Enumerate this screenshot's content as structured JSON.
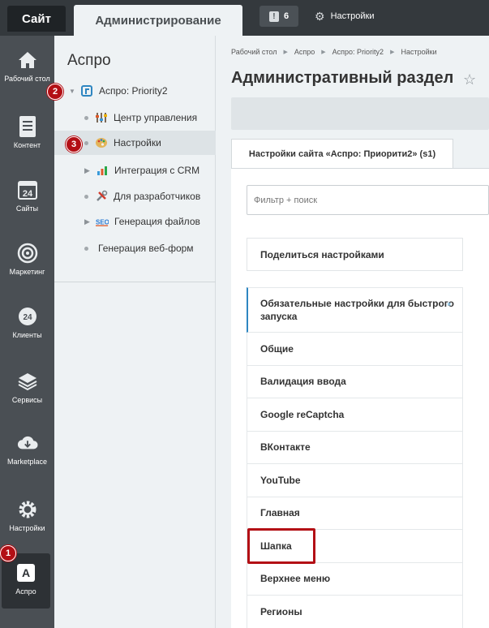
{
  "topbar": {
    "site_tab": "Сайт",
    "admin_tab": "Администрирование",
    "notifications_count": "6",
    "settings_label": "Настройки"
  },
  "leftmenu": {
    "items": [
      {
        "label": "Рабочий стол",
        "icon": "home-icon"
      },
      {
        "label": "Контент",
        "icon": "document-icon"
      },
      {
        "label": "Сайты",
        "icon": "calendar-24-icon"
      },
      {
        "label": "Маркетинг",
        "icon": "target-icon"
      },
      {
        "label": "Клиенты",
        "icon": "clients-24-icon"
      },
      {
        "label": "Сервисы",
        "icon": "layers-icon"
      },
      {
        "label": "Marketplace",
        "icon": "cloud-download-icon"
      },
      {
        "label": "Настройки",
        "icon": "gear-icon"
      },
      {
        "label": "Аспро",
        "icon": "aspro-logo-icon",
        "glyph": "A"
      }
    ]
  },
  "secmenu": {
    "title": "Аспро",
    "items": [
      {
        "label": "Аспро: Priority2"
      },
      {
        "label": "Центр управления"
      },
      {
        "label": "Настройки"
      },
      {
        "label": "Интеграция с CRM"
      },
      {
        "label": "Для разработчиков"
      },
      {
        "label": "Генерация файлов"
      },
      {
        "label": "Генерация веб-форм"
      }
    ]
  },
  "badges": {
    "b1": "1",
    "b2": "2",
    "b3": "3"
  },
  "main": {
    "breadcrumb": [
      "Рабочий стол",
      "Аспро",
      "Аспро: Priority2",
      "Настройки"
    ],
    "title": "Административный раздел",
    "tab_label": "Настройки сайта «Аспро: Приорити2» (s1)",
    "filter_placeholder": "Фильтр + поиск",
    "share_label": "Поделиться настройками",
    "list": [
      "Обязательные настройки для быстрого запуска",
      "Общие",
      "Валидация ввода",
      "Google reCaptcha",
      "ВКонтакте",
      "YouTube",
      "Главная",
      "Шапка",
      "Верхнее меню",
      "Регионы"
    ]
  },
  "colors": {
    "highlight": "#b30f15",
    "active_border": "#2e86c1",
    "dark_menu": "#4a4f54"
  }
}
